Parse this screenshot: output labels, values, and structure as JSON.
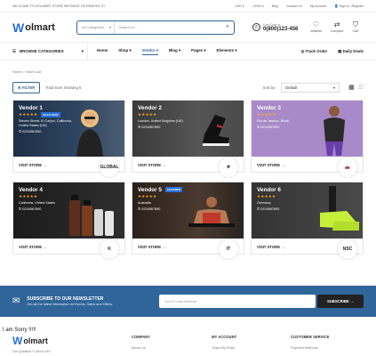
{
  "topbar": {
    "welcome": "WELCOME TO WOLMART STORE MESSAGE OR REMOVE IT!",
    "currency": "USD",
    "language": "ENG",
    "links": [
      "Blog",
      "Contact Us",
      "My Account"
    ],
    "signin": "Sign in / Register"
  },
  "header": {
    "logo": "olmart",
    "search": {
      "category": "All Categories",
      "placeholder": "Search in..."
    },
    "call": {
      "label": "Live Chat or :",
      "number": "0(800)123-456"
    },
    "icons": [
      {
        "icon": "heart-icon",
        "label": "Wishlist"
      },
      {
        "icon": "compare-icon",
        "label": "Compare"
      },
      {
        "icon": "cart-icon",
        "label": "Cart"
      }
    ]
  },
  "nav": {
    "browse": "BROWSE CATEGORIES",
    "menu": [
      "Home",
      "Shop",
      "Vendor",
      "Blog",
      "Pages",
      "Elements"
    ],
    "active": "Vendor",
    "right": [
      "Track Order",
      "Daily Deals"
    ]
  },
  "breadcrumb": [
    "Home",
    "Store List"
  ],
  "toolbar": {
    "filter": "FILTER",
    "showing": "Total store Showing 6",
    "sort_label": "Sort by:",
    "sort_value": "Default"
  },
  "vendors": [
    {
      "name": "Vendor 1",
      "featured": "FEATURED",
      "address": "Steven Street, El Carjon, California, United States (US)",
      "phone": "0234567890",
      "logo": "GLOBAL",
      "cta": "VISIT STORE"
    },
    {
      "name": "Vendor 2",
      "featured": "",
      "address": "London, United Kingdom (UK)",
      "phone": "0234567890",
      "logo": "✲",
      "cta": "VISIT STORE"
    },
    {
      "name": "Vendor 3",
      "featured": "",
      "address": "Rio de Janeiro, Brazil",
      "phone": "0234567890",
      "logo": "🚗",
      "cta": "VISIT STORE"
    },
    {
      "name": "Vendor 4",
      "featured": "",
      "address": "California, United States",
      "phone": "0234567890",
      "logo": "K",
      "cta": "VISIT STORE"
    },
    {
      "name": "Vendor 5",
      "featured": "FEATURED",
      "address": "Australia",
      "phone": "0234567890",
      "logo": "IT",
      "cta": "VISIT STORE"
    },
    {
      "name": "Vendor 6",
      "featured": "",
      "address": "Germany",
      "phone": "0234567890",
      "logo": "NSC",
      "cta": "VISIT STORE"
    }
  ],
  "newsletter": {
    "title": "SUBSCRIBE TO OUR NEWSLETTER",
    "subtitle": "Get all the latest information on Events, Sales and Offers.",
    "placeholder": "Your E-mail Address",
    "button": "SUBSCRIBE"
  },
  "footer": {
    "error": "I am Sorry !!!!!",
    "logo": "olmart",
    "sub": "Got Question? Call us 24/7",
    "columns": [
      {
        "title": "COMPANY",
        "link": "About Us"
      },
      {
        "title": "MY ACCOUNT",
        "link": "Track My Order"
      },
      {
        "title": "CUSTOMER SERVICE",
        "link": "Payment Methods"
      }
    ]
  },
  "colors": {
    "accent": "#336699",
    "newsletter": "#30659a",
    "stars": "#f5a623"
  }
}
